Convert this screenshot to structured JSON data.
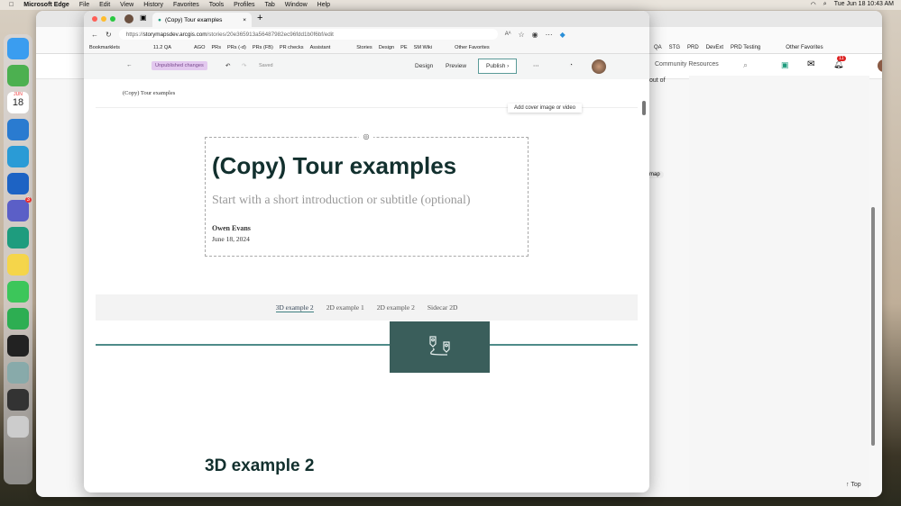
{
  "menubar": {
    "app": "Microsoft Edge",
    "items": [
      "File",
      "Edit",
      "View",
      "History",
      "Favorites",
      "Tools",
      "Profiles",
      "Tab",
      "Window",
      "Help"
    ],
    "clock": "Tue Jun 18  10:43 AM"
  },
  "dock": {
    "calendar_month": "JUN",
    "calendar_day": "18",
    "teams_badge": "3"
  },
  "back_window": {
    "bookmarks": [
      "QA",
      "STG",
      "PRD",
      "DevExt",
      "PRD Testing",
      "Other Favorites"
    ],
    "search_placeholder": "Community Resources",
    "notification_count": "11",
    "side_text": "out of",
    "chip": "map",
    "top_link": "Top"
  },
  "browser": {
    "tab_title": "(Copy) Tour examples",
    "url_prefix": "https://",
    "url_host": "storymapsdev.arcgis.com",
    "url_path": "/stories/20e365913a56487982ec96fdd1b0f6bf/edit",
    "bookmarks": [
      "Bookmarklets",
      "11.2 QA",
      "AGO",
      "PRs",
      "PRs (-d)",
      "PRs (FB)",
      "PR checks",
      "Assistant",
      "Stories",
      "Design",
      "PE",
      "SM Wiki",
      "Other Favorites"
    ]
  },
  "story_header": {
    "unpublished": "Unpublished changes",
    "saved": "Saved",
    "design": "Design",
    "preview": "Preview",
    "publish": "Publish"
  },
  "story": {
    "bar_title": "(Copy) Tour examples",
    "cover_button": "Add cover image or video",
    "title": "(Copy) Tour examples",
    "subtitle": "Start with a short introduction or subtitle (optional)",
    "author": "Owen Evans",
    "date": "June 18, 2024",
    "nav": [
      "3D example 2",
      "2D example 1",
      "2D example 2",
      "Sidecar 2D"
    ],
    "section_heading": "3D example 2"
  },
  "colors": {
    "accent": "#3e7f80",
    "map_block": "#3a5e5b",
    "title": "#12302e",
    "unpublished_bg": "#e3c9ef"
  }
}
